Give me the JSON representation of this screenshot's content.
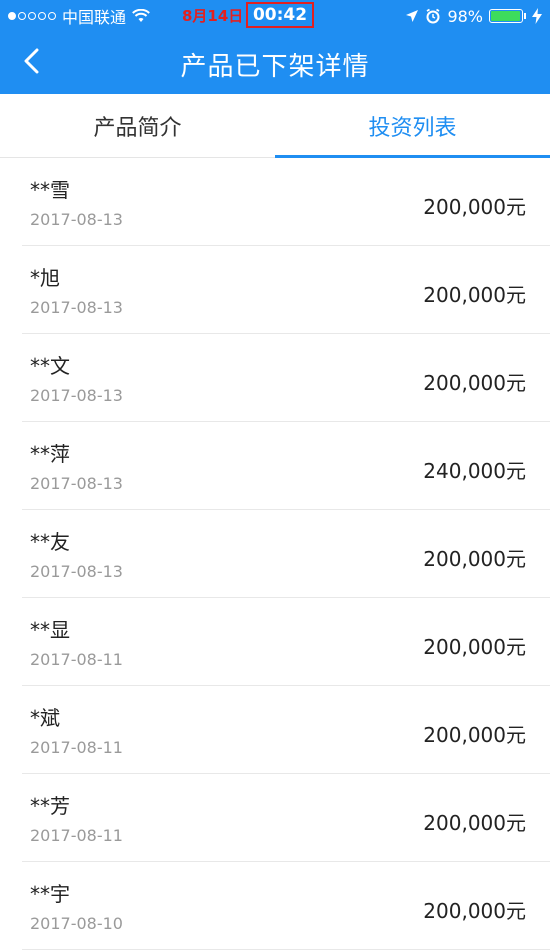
{
  "status_bar": {
    "carrier": "中国联通",
    "date_annotation": "8月14日",
    "time": "00:42",
    "battery": "98%",
    "battery_level": 0.98
  },
  "navbar": {
    "title": "产品已下架详情"
  },
  "tabs": [
    {
      "label": "产品简介",
      "active": false
    },
    {
      "label": "投资列表",
      "active": true
    }
  ],
  "investments": [
    {
      "name": "**雪",
      "date": "2017-08-13",
      "amount": "200,000元"
    },
    {
      "name": "*旭",
      "date": "2017-08-13",
      "amount": "200,000元"
    },
    {
      "name": "**文",
      "date": "2017-08-13",
      "amount": "200,000元"
    },
    {
      "name": "**萍",
      "date": "2017-08-13",
      "amount": "240,000元"
    },
    {
      "name": "**友",
      "date": "2017-08-13",
      "amount": "200,000元"
    },
    {
      "name": "**显",
      "date": "2017-08-11",
      "amount": "200,000元"
    },
    {
      "name": "*斌",
      "date": "2017-08-11",
      "amount": "200,000元"
    },
    {
      "name": "**芳",
      "date": "2017-08-11",
      "amount": "200,000元"
    },
    {
      "name": "**宇",
      "date": "2017-08-10",
      "amount": "200,000元"
    }
  ],
  "colors": {
    "header_blue": "#1f8ef2",
    "annotation_red": "#e32020",
    "battery_green": "#3ddc5c"
  }
}
